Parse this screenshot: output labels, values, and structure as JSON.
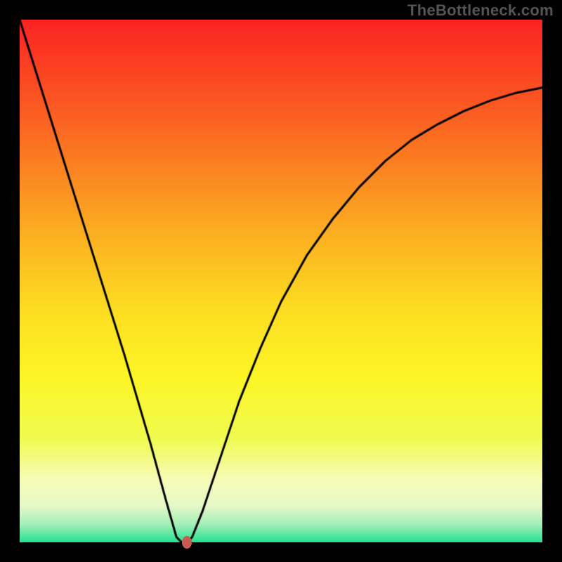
{
  "watermark": "TheBottleneck.com",
  "chart_data": {
    "type": "line",
    "title": "",
    "xlabel": "",
    "ylabel": "",
    "xlim": [
      0,
      100
    ],
    "ylim": [
      0,
      100
    ],
    "grid": false,
    "series": [
      {
        "name": "curve",
        "x": [
          0,
          5,
          10,
          15,
          20,
          25,
          28,
          30,
          31,
          32,
          33,
          35,
          38,
          42,
          46,
          50,
          55,
          60,
          65,
          70,
          75,
          80,
          85,
          90,
          95,
          100
        ],
        "y": [
          100,
          84,
          68,
          52,
          36,
          19,
          8,
          1,
          0,
          0,
          1,
          6,
          15,
          27,
          37,
          46,
          55,
          62,
          68,
          73,
          77,
          80,
          82.5,
          84.5,
          86,
          87
        ]
      }
    ],
    "marker": {
      "x": 32,
      "y": 0
    },
    "gradient_stops": [
      {
        "offset": 0.0,
        "color": "#fb2323"
      },
      {
        "offset": 0.2,
        "color": "#fb6522"
      },
      {
        "offset": 0.4,
        "color": "#fcac21"
      },
      {
        "offset": 0.55,
        "color": "#fddc22"
      },
      {
        "offset": 0.68,
        "color": "#fdf525"
      },
      {
        "offset": 0.8,
        "color": "#f0fb4f"
      },
      {
        "offset": 0.88,
        "color": "#f8fcb9"
      },
      {
        "offset": 0.93,
        "color": "#e6f8c8"
      },
      {
        "offset": 0.965,
        "color": "#a7efb9"
      },
      {
        "offset": 1.0,
        "color": "#23e191"
      }
    ],
    "line_color": "#000000",
    "line_width": 3,
    "marker_color": "#c95a52"
  }
}
